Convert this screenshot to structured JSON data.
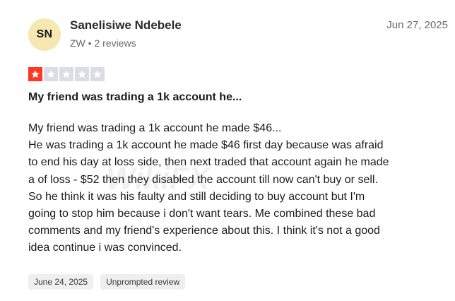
{
  "reviewer": {
    "initials": "SN",
    "name": "Sanelisiwe Ndebele",
    "meta": "ZW • 2 reviews"
  },
  "review": {
    "date": "Jun 27, 2025",
    "rating": 1,
    "rating_max": 5,
    "title": "My friend was trading a 1k account he...",
    "body_lines": [
      "My friend was trading a 1k account he made $46...",
      "He was trading a 1k account he made $46 first day because was afraid",
      "to end his day at loss side, then next traded that account again he made",
      "a of loss - $52 then they disabled the account till now can't buy or sell.",
      "So he think it was his faulty and still deciding to buy account but I'm",
      "going to stop him because i don't want tears. Me combined these bad",
      "comments and my friend's experience about this. I think it's not a good",
      "idea continue i was convinced."
    ],
    "watermark": "WikiFX",
    "tags": {
      "experience_date": "June 24, 2025",
      "type": "Unprompted review"
    }
  },
  "colors": {
    "star_filled": "#ff3722",
    "star_empty": "#dcdce6",
    "avatar_bg": "#f6e8b0"
  },
  "icons": {
    "star": "star-icon"
  }
}
